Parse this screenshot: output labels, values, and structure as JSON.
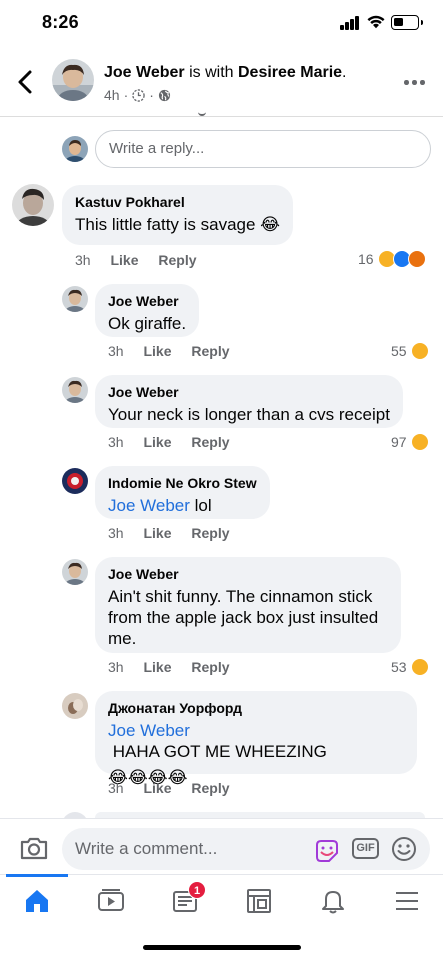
{
  "status": {
    "time": "8:26"
  },
  "post": {
    "author": "Joe Weber",
    "with_word": "is with",
    "tagged": "Desiree Marie",
    "title_end": ".",
    "time": "4h",
    "sep": "·"
  },
  "reply_placeholder": "Write a reply...",
  "comments": [
    {
      "author": "Kastuv Pokharel",
      "text": "This little fatty is savage 😂",
      "time": "3h",
      "like": "Like",
      "reply": "Reply",
      "reactions": "16"
    },
    {
      "author": "Joe Weber",
      "text": "Ok giraffe.",
      "time": "3h",
      "like": "Like",
      "reply": "Reply",
      "reactions": "55"
    },
    {
      "author": "Joe Weber",
      "text": "Your neck is longer than a cvs receipt",
      "time": "3h",
      "like": "Like",
      "reply": "Reply",
      "reactions": "97"
    },
    {
      "author": "Indomie Ne Okro Stew",
      "mention": "Joe Weber",
      "text": " lol",
      "time": "3h",
      "like": "Like",
      "reply": "Reply",
      "reactions": ""
    },
    {
      "author": "Joe Weber",
      "text": "Ain't shit funny. The cinnamon stick from the apple jack box just insulted me.",
      "time": "3h",
      "like": "Like",
      "reply": "Reply",
      "reactions": "53"
    },
    {
      "author": "Джонатан Уорфорд",
      "mention": "Joe Weber",
      "text": " HAHA GOT ME WHEEZING",
      "emoji": "😂😂😂😂",
      "time": "3h",
      "like": "Like",
      "reply": "Reply",
      "reactions": ""
    }
  ],
  "composer": {
    "placeholder": "Write a comment...",
    "gif_label": "GIF"
  },
  "tabs": {
    "active": "home",
    "items": [
      "home-icon",
      "watch-icon",
      "news-icon",
      "marketplace-icon",
      "bell-icon",
      "menu-icon"
    ],
    "news_badge": "1"
  },
  "colors": {
    "accent": "#1877f2",
    "mention": "#216fdb",
    "bubble": "#f0f2f5",
    "badge": "#e41e3f",
    "haha": "#f7b125",
    "love": "#f33e58",
    "like": "#1877f2",
    "angry": "#e9710f"
  }
}
